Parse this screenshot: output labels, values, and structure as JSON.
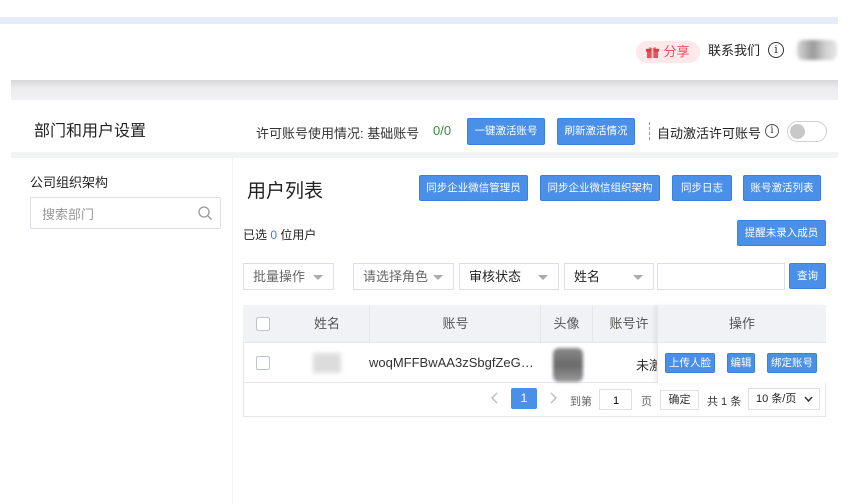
{
  "header": {
    "share_label": "分享",
    "contact_label": "联系我们",
    "info_glyph": "i"
  },
  "page": {
    "title": "部门和用户设置",
    "permit_label": "许可账号使用情况: 基础账号",
    "permit_count": "0/0",
    "activate_button": "一键激活账号",
    "refresh_button": "刷新激活情况",
    "auto_activate_label": "自动激活许可账号",
    "auto_activate_enabled": false
  },
  "sidebar": {
    "title": "公司组织架构",
    "search_placeholder": "搜索部门"
  },
  "user_list": {
    "title": "用户列表",
    "buttons": {
      "sync_admin": "同步企业微信管理员",
      "sync_org": "同步企业微信组织架构",
      "sync_log": "同步日志",
      "activation_list": "账号激活列表",
      "remind_unrecorded": "提醒未录入成员"
    },
    "selected_prefix": "已选",
    "selected_count": "0",
    "selected_suffix": "位用户",
    "filters": {
      "bulk_action": "批量操作",
      "role": "请选择角色",
      "review_status": "审核状态",
      "search_field": "姓名",
      "keyword_value": "",
      "query_button": "查询"
    },
    "table": {
      "columns": [
        "姓名",
        "账号",
        "头像",
        "账号许",
        "操作"
      ],
      "rows": [
        {
          "account": "woqMFFBwAA3zSbgfZeG6t...",
          "status": "未激",
          "actions": [
            "上传人脸",
            "编辑",
            "绑定账号"
          ]
        }
      ]
    },
    "pagination": {
      "current_page": "1",
      "goto_label": "到第",
      "goto_value": "1",
      "page_unit": "页",
      "confirm_button": "确定",
      "total": "共 1 条",
      "page_size": "10 条/页"
    }
  },
  "colors": {
    "primary": "#4a8fe8",
    "share": "#e8505b",
    "count_green": "#3a8a3a"
  }
}
